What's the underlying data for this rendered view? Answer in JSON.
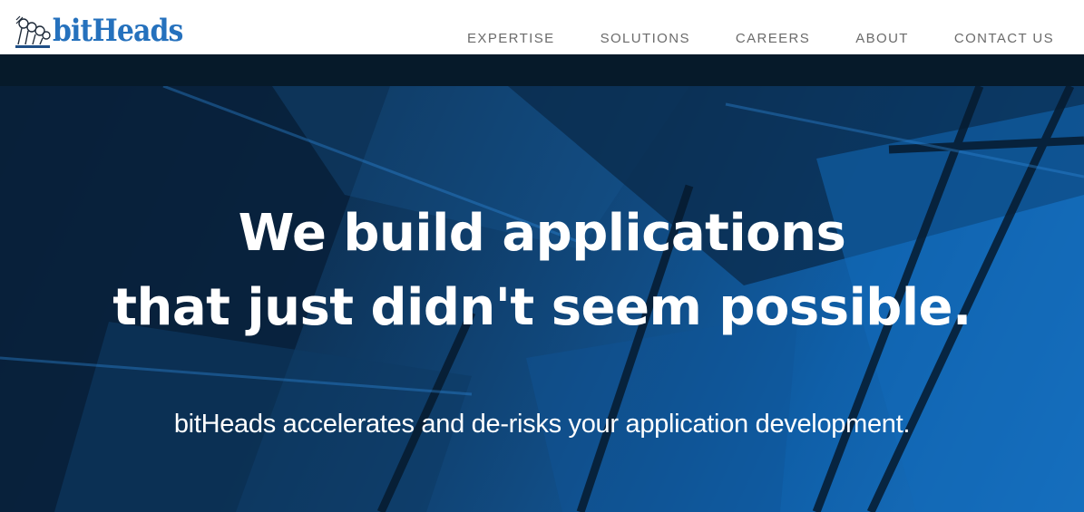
{
  "brand": {
    "name": "bitHeads",
    "color": "#2571bd"
  },
  "nav": {
    "items": [
      {
        "label": "EXPERTISE"
      },
      {
        "label": "SOLUTIONS"
      },
      {
        "label": "CAREERS"
      },
      {
        "label": "ABOUT"
      },
      {
        "label": "CONTACT US"
      }
    ]
  },
  "hero": {
    "title_line1": "We build applications",
    "title_line2": "that just didn't seem possible.",
    "subtitle": "bitHeads accelerates and de-risks your application development."
  },
  "colors": {
    "nav_text": "#6b6b6b",
    "dark_band": "#061a2a",
    "hero_blue": "#1a74c4"
  }
}
